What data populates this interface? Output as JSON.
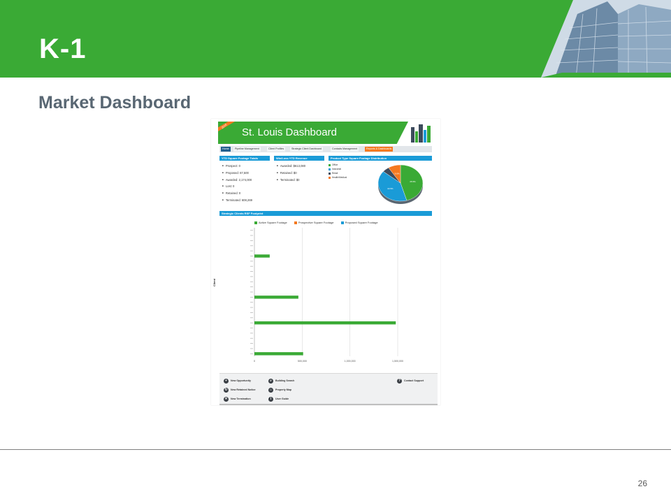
{
  "slide": {
    "title": "K-1",
    "subtitle": "Market Dashboard",
    "page_number": "26",
    "accent_color": "#3aaa35"
  },
  "dashboard": {
    "ribbon": "2016",
    "title": "St. Louis Dashboard",
    "nav": [
      "Home",
      "Pipeline Management",
      "Client Profiles",
      "Strategic Client Dashboard",
      "Contacts Management",
      "Reports & Dashboards"
    ],
    "ytd_sqft": {
      "header": "YTD Square Footage Totals",
      "items": [
        "Prospect: 0",
        "Proposed: 67,500",
        "Awarded: 2,174,000",
        "Lost: 0",
        "Retained: 0",
        "Terminated: 608,269"
      ]
    },
    "win_loss": {
      "header": "Win/Loss YTD Revenue",
      "items": [
        "Awarded: $613,080",
        "Retained: $0",
        "Terminated: $0"
      ]
    },
    "product_type": {
      "header": "Product Type Square Footage Distribution",
      "legend": [
        {
          "label": "Office",
          "color": "#3aaa35"
        },
        {
          "label": "Industrial",
          "color": "#1a9bd7"
        },
        {
          "label": "Retail",
          "color": "#3d4b5c"
        },
        {
          "label": "Health/Medical",
          "color": "#f47920"
        }
      ]
    },
    "strategic_clients": {
      "header": "Strategic Clients RSF Footprint",
      "legend": [
        {
          "label": "Active Square Footage",
          "color": "#3aaa35"
        },
        {
          "label": "Prospective Square Footage",
          "color": "#f47920"
        },
        {
          "label": "Proposed Square Footage",
          "color": "#1a9bd7"
        }
      ],
      "y_axis_title": "Client",
      "x_ticks": [
        "0",
        "500,000",
        "1,000,000",
        "1,500,000"
      ]
    },
    "footer": {
      "new_opportunity": "New Opportunity",
      "new_retained": "New Retained Notice",
      "new_termination": "New Termination",
      "building_search": "Building Search",
      "property_map": "Property Map",
      "user_guide": "User Guide",
      "contact_support": "Contact Support"
    }
  },
  "chart_data": [
    {
      "type": "pie",
      "title": "Product Type Square Footage Distribution",
      "categories": [
        "Office",
        "Industrial",
        "Retail",
        "Health/Medical"
      ],
      "values": [
        45.5,
        40.5,
        5.0,
        9.0
      ],
      "slice_labels": [
        "45.5%",
        "40.5%",
        "",
        "9.0%"
      ],
      "colors": [
        "#3aaa35",
        "#1a9bd7",
        "#3d4b5c",
        "#f47920"
      ]
    },
    {
      "type": "bar",
      "orientation": "horizontal",
      "title": "Strategic Clients RSF Footprint",
      "ylabel": "Client",
      "xlim": [
        0,
        1800000
      ],
      "x_ticks": [
        0,
        500000,
        1000000,
        1500000
      ],
      "rows": 22,
      "series": [
        {
          "name": "Active Square Footage",
          "color": "#3aaa35",
          "values": [
            0,
            0,
            0,
            0,
            0,
            160000,
            0,
            0,
            0,
            0,
            0,
            0,
            0,
            460000,
            0,
            0,
            0,
            0,
            1480000,
            0,
            0,
            0,
            0,
            0,
            510000
          ]
        }
      ]
    }
  ]
}
